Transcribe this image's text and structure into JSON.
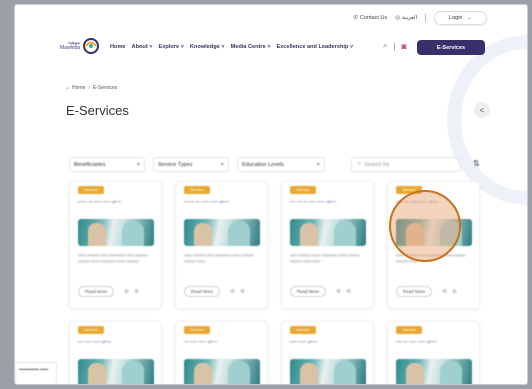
{
  "topbar": {
    "contact": "Contact Us",
    "language": "العربية",
    "login": "Login"
  },
  "logo": {
    "arabic": "موهبة",
    "english": "Mawhiba"
  },
  "nav": {
    "items": [
      "Home",
      "About",
      "Explore",
      "Knowledge",
      "Media Centre",
      "Excellence and Leadership"
    ],
    "eservices": "E-Services"
  },
  "breadcrumb": {
    "home": "Home",
    "current": "E-Services"
  },
  "page": {
    "title": "E-Services"
  },
  "filters": {
    "beneficiaries": "Beneficiaries",
    "service_types": "Service Types",
    "education_levels": "Education Levels",
    "search_placeholder": "Search for"
  },
  "cards": [
    {
      "badge": "Service",
      "title": "ــــي ـــــ ـــــ ـــ ــــــ",
      "button": "Read More"
    },
    {
      "badge": "Service",
      "title": "ــــي ـــــ ـــــ ـــ ـــــــ",
      "button": "Read More"
    },
    {
      "badge": "Service",
      "title": "ــــي ـــــ ـــــ ـــ ـــ ــــ",
      "button": "Read More"
    },
    {
      "badge": "Service",
      "title": "ــــي ـــــ ـــــ ـــ ـــــ",
      "button": "Read More"
    },
    {
      "badge": "Service",
      "title": "ــــي ـــــ ـــــ ـــ",
      "button": ""
    },
    {
      "badge": "Service",
      "title": "ــــي ـــــ ـــــ ـــ",
      "button": ""
    },
    {
      "badge": "Service",
      "title": "ــــي ـــــ ـــــ",
      "button": ""
    },
    {
      "badge": "Service",
      "title": "ــــي ـــــ ـــــ ـــ ــــ",
      "button": ""
    }
  ],
  "colors": {
    "brand": "#3a2f6b",
    "badge": "#e9a830",
    "highlight": "#c8731c"
  }
}
